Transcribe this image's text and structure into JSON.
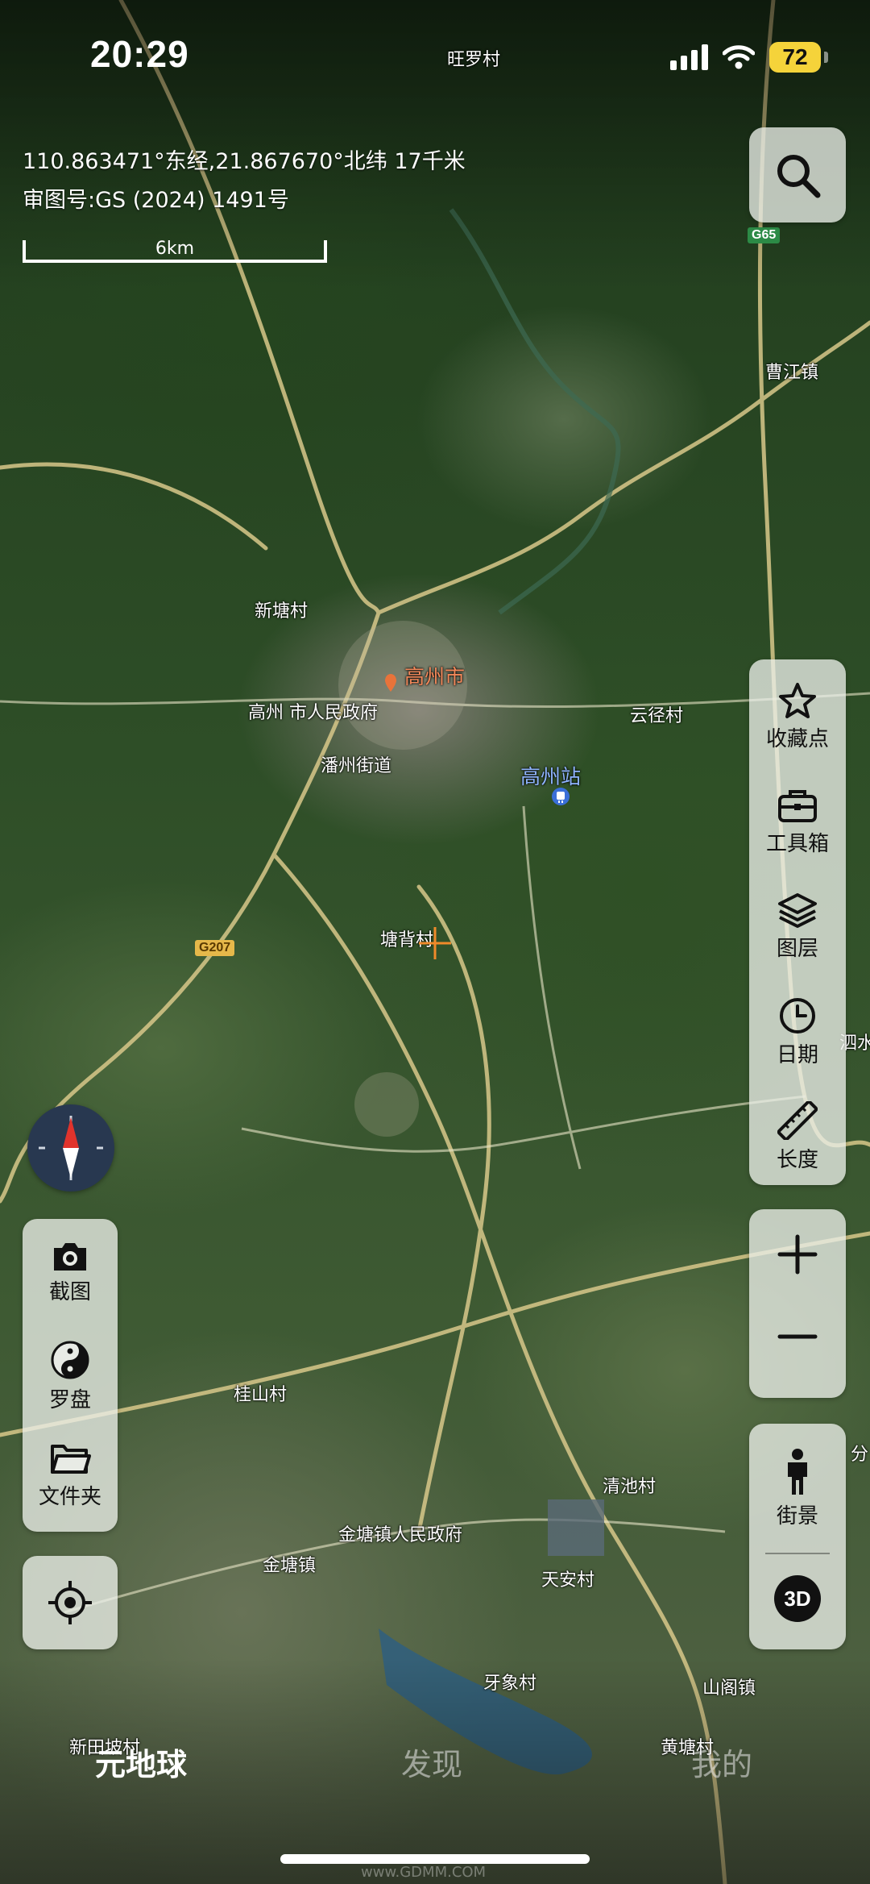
{
  "status_bar": {
    "time": "20:29",
    "battery": "72"
  },
  "map_info": {
    "coordinates": "110.863471°东经,21.867670°北纬 17千米",
    "review_number": "审图号:GS (2024) 1491号",
    "scale": "6km"
  },
  "map_labels": {
    "place_1": "旺罗村",
    "place_2": "曹江镇",
    "place_3": "新塘村",
    "city": "高州市",
    "place_5": "高州 市人民政府",
    "place_6": "潘州街道",
    "station": "高州站",
    "place_8": "云径村",
    "place_9": "塘背村",
    "place_10": "桂山村",
    "place_11": "金塘镇人民政府",
    "place_12": "金塘镇",
    "place_13": "清池村",
    "place_14": "天安村",
    "place_15": "牙象村",
    "place_16": "新田坡村",
    "place_17": "黄塘村",
    "place_18": "山阁镇",
    "place_19": "泗水",
    "place_20": "分",
    "road_g65": "G65",
    "road_g207": "G207"
  },
  "toolbar_right": {
    "favorites": "收藏点",
    "toolbox": "工具箱",
    "layers": "图层",
    "date": "日期",
    "length": "长度",
    "street_view": "街景",
    "three_d": "3D"
  },
  "toolbar_left": {
    "screenshot": "截图",
    "compass": "罗盘",
    "folder": "文件夹"
  },
  "tabs": [
    "元地球",
    "发现",
    "我的"
  ],
  "watermark": "www.GDMM.COM",
  "colors": {
    "city_label": "#f2885a",
    "station_label": "#8fb4ff",
    "battery": "#f5d33a",
    "crosshair": "#f08a2a",
    "compass_needle": "#e0332c"
  }
}
